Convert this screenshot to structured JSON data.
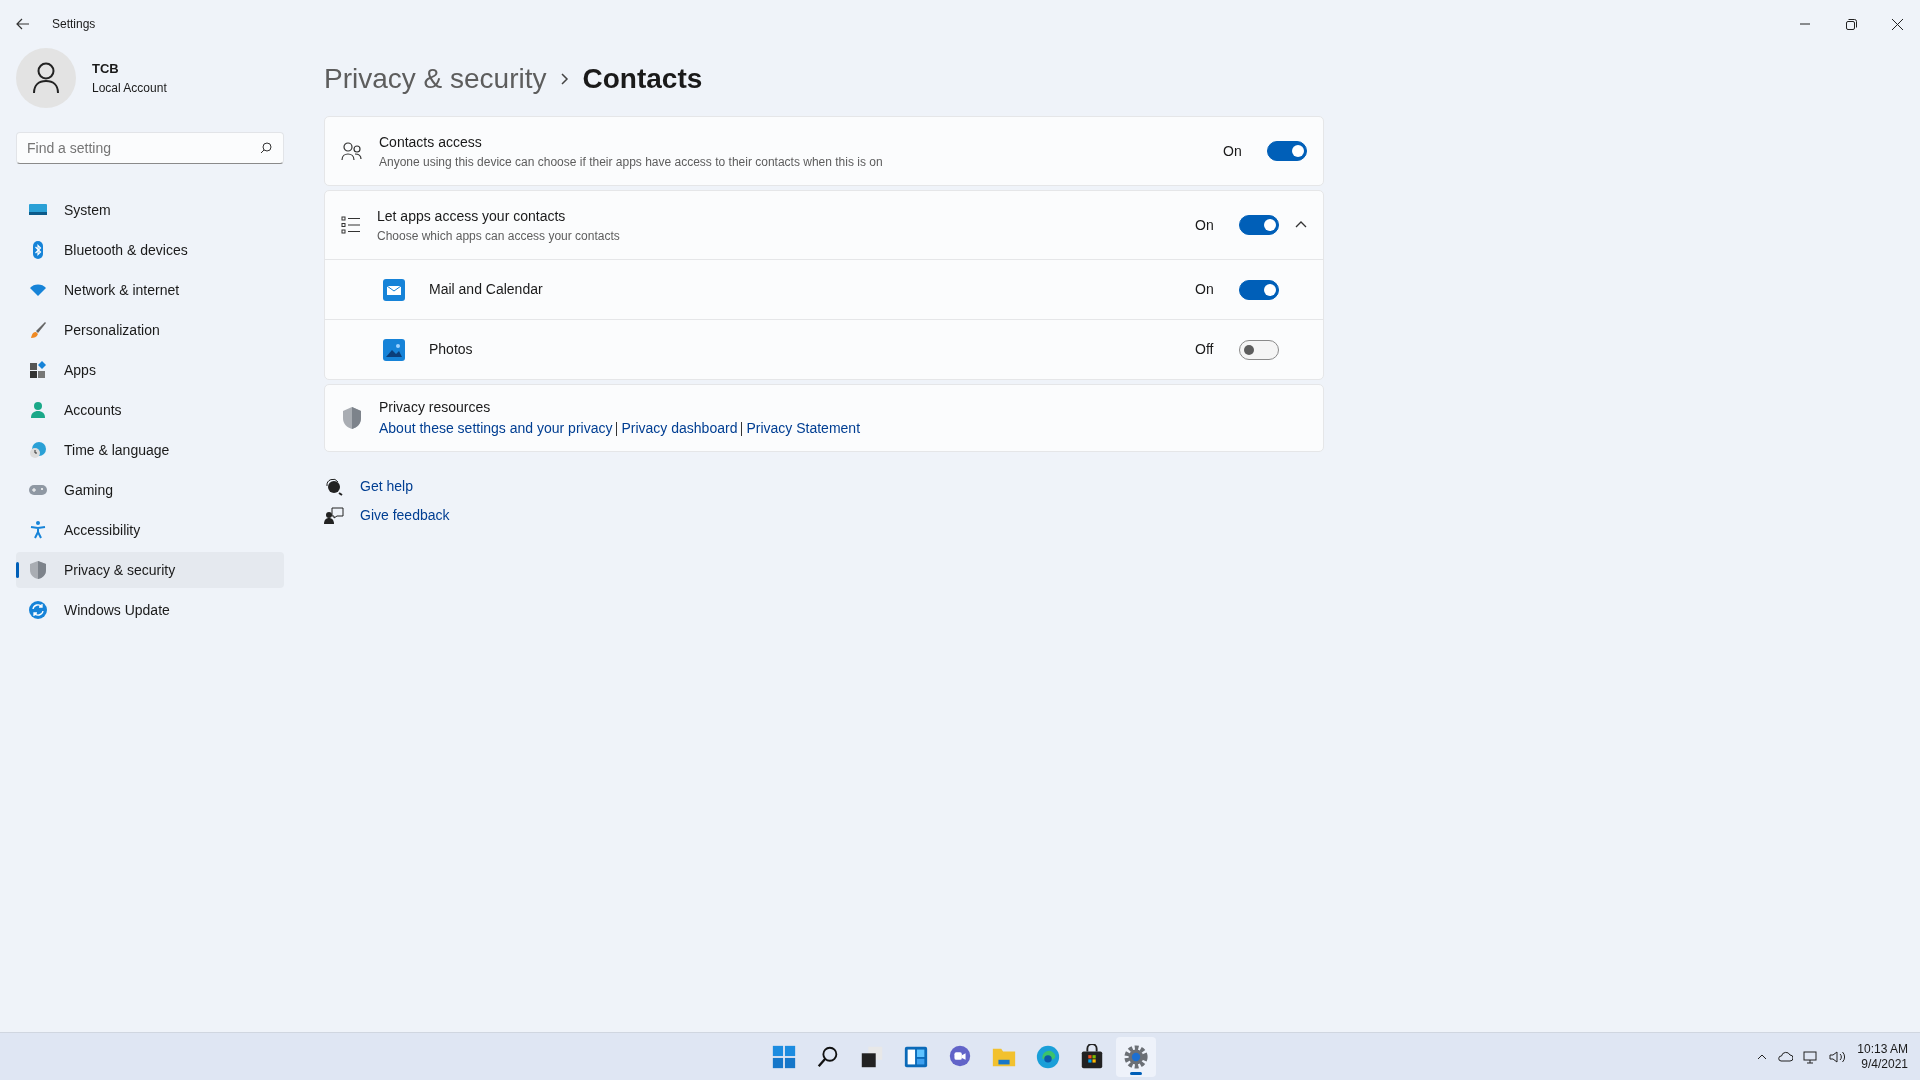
{
  "window": {
    "title": "Settings"
  },
  "account": {
    "name": "TCB",
    "type": "Local Account"
  },
  "search": {
    "placeholder": "Find a setting"
  },
  "nav": [
    {
      "label": "System",
      "kind": "system",
      "selected": false
    },
    {
      "label": "Bluetooth & devices",
      "kind": "bluetooth",
      "selected": false
    },
    {
      "label": "Network & internet",
      "kind": "network",
      "selected": false
    },
    {
      "label": "Personalization",
      "kind": "brush",
      "selected": false
    },
    {
      "label": "Apps",
      "kind": "apps",
      "selected": false
    },
    {
      "label": "Accounts",
      "kind": "accounts",
      "selected": false
    },
    {
      "label": "Time & language",
      "kind": "time",
      "selected": false
    },
    {
      "label": "Gaming",
      "kind": "gaming",
      "selected": false
    },
    {
      "label": "Accessibility",
      "kind": "accessibility",
      "selected": false
    },
    {
      "label": "Privacy & security",
      "kind": "shield",
      "selected": true
    },
    {
      "label": "Windows Update",
      "kind": "update",
      "selected": false
    }
  ],
  "breadcrumb": {
    "parent": "Privacy & security",
    "current": "Contacts"
  },
  "settings": [
    {
      "kind": "toggle",
      "title": "Contacts access",
      "description": "Anyone using this device can choose if their apps have access to their contacts when this is on",
      "state_label": "On",
      "on": true
    },
    {
      "kind": "group",
      "title": "Let apps access your contacts",
      "description": "Choose which apps can access your contacts",
      "state_label": "On",
      "on": true,
      "expanded": true,
      "apps": [
        {
          "name": "Mail and Calendar",
          "kind": "mail",
          "state_label": "On",
          "on": true
        },
        {
          "name": "Photos",
          "kind": "photos",
          "state_label": "Off",
          "on": false
        }
      ]
    }
  ],
  "resources": {
    "title": "Privacy resources",
    "links": [
      "About these settings and your privacy",
      "Privacy dashboard",
      "Privacy Statement"
    ]
  },
  "help_links": [
    {
      "label": "Get help",
      "kind": "help"
    },
    {
      "label": "Give feedback",
      "kind": "feedback"
    }
  ],
  "taskbar": [
    {
      "kind": "start",
      "selected": false
    },
    {
      "kind": "search",
      "selected": false
    },
    {
      "kind": "taskview",
      "selected": false
    },
    {
      "kind": "widgets",
      "selected": false
    },
    {
      "kind": "chat",
      "selected": false
    },
    {
      "kind": "explorer",
      "selected": false
    },
    {
      "kind": "edge",
      "selected": false
    },
    {
      "kind": "store",
      "selected": false
    },
    {
      "kind": "settings",
      "selected": true
    }
  ],
  "clock": {
    "time": "10:13 AM",
    "date": "9/4/2021"
  }
}
